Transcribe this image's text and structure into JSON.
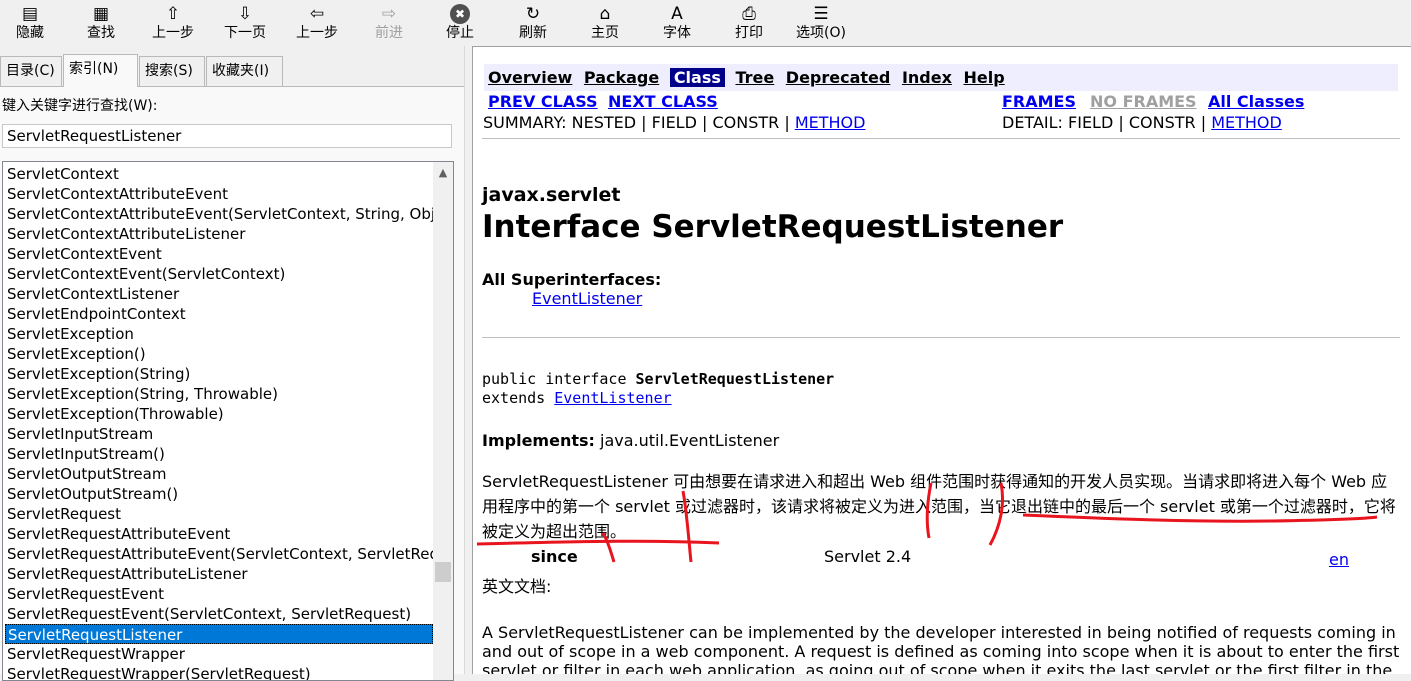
{
  "toolbar": {
    "buttons": [
      {
        "label": "隐藏",
        "icon": "hide-icon"
      },
      {
        "label": "查找",
        "icon": "locate-icon"
      },
      {
        "label": "上一步",
        "icon": "up-arrow-icon"
      },
      {
        "label": "下一页",
        "icon": "down-arrow-icon"
      },
      {
        "label": "上一步",
        "icon": "back-arrow-icon"
      },
      {
        "label": "前进",
        "icon": "forward-arrow-icon"
      },
      {
        "label": "停止",
        "icon": "stop-icon"
      },
      {
        "label": "刷新",
        "icon": "refresh-icon"
      },
      {
        "label": "主页",
        "icon": "home-icon"
      },
      {
        "label": "字体",
        "icon": "font-icon"
      },
      {
        "label": "打印",
        "icon": "print-icon"
      },
      {
        "label": "选项(O)",
        "icon": "options-icon"
      }
    ]
  },
  "tabs": [
    "目录(C)",
    "索引(N)",
    "搜索(S)",
    "收藏夹(I)"
  ],
  "index": {
    "keyword_label": "键入关键字进行查找(W):",
    "keyword_value": "ServletRequestListener",
    "items": [
      "ServletContext",
      "ServletContextAttributeEvent",
      "ServletContextAttributeEvent(ServletContext, String, Object)",
      "ServletContextAttributeListener",
      "ServletContextEvent",
      "ServletContextEvent(ServletContext)",
      "ServletContextListener",
      "ServletEndpointContext",
      "ServletException",
      "ServletException()",
      "ServletException(String)",
      "ServletException(String, Throwable)",
      "ServletException(Throwable)",
      "ServletInputStream",
      "ServletInputStream()",
      "ServletOutputStream",
      "ServletOutputStream()",
      "ServletRequest",
      "ServletRequestAttributeEvent",
      "ServletRequestAttributeEvent(ServletContext, ServletRequest)",
      "ServletRequestAttributeListener",
      "ServletRequestEvent",
      "ServletRequestEvent(ServletContext, ServletRequest)",
      "ServletRequestListener",
      "ServletRequestWrapper",
      "ServletRequestWrapper(ServletRequest)"
    ],
    "selected": "ServletRequestListener"
  },
  "doc": {
    "nav": [
      "Overview",
      "Package",
      "Class",
      "Tree",
      "Deprecated",
      "Index",
      "Help"
    ],
    "prev_class": "PREV CLASS",
    "next_class": "NEXT CLASS",
    "frames": "FRAMES",
    "no_frames": "NO FRAMES",
    "all_classes": "All Classes",
    "summary_prefix": "SUMMARY: NESTED | FIELD | CONSTR | ",
    "summary_method": "METHOD",
    "detail_prefix": "DETAIL: FIELD | CONSTR | ",
    "detail_method": "METHOD",
    "package": "javax.servlet",
    "title": "Interface ServletRequestListener",
    "superinterfaces_label": "All Superinterfaces:",
    "superinterfaces_value": "EventListener",
    "decl_line1_prefix": "public interface ",
    "decl_line1_name": "ServletRequestListener",
    "decl_line2_prefix": "extends ",
    "decl_line2_link": "EventListener",
    "implements_label": "Implements:",
    "implements_value": "java.util.EventListener",
    "cn_description": "ServletRequestListener 可由想要在请求进入和超出 Web 组件范围时获得通知的开发人员实现。当请求即将进入每个 Web 应用程序中的第一个 servlet 或过滤器时，该请求将被定义为进入范围，当它退出链中的最后一个 servlet 或第一个过滤器时，它将被定义为超出范围。",
    "since_label": "since",
    "since_value": "Servlet 2.4",
    "en_link": "en",
    "en_doc_label": "英文文档:",
    "en_description": "A ServletRequestListener can be implemented by the developer interested in being notified of requests coming in and out of scope in a web component. A request is defined as coming into scope when it is about to enter the first servlet or filter in each web application, as going out of scope when it exits the last servlet or the first filter in the chain."
  },
  "colors": {
    "selection": "#0078d7",
    "link": "#0000ee",
    "nav_current": "#00008b",
    "nav_bg": "#eeeeff",
    "annotation": "#e8141e"
  }
}
